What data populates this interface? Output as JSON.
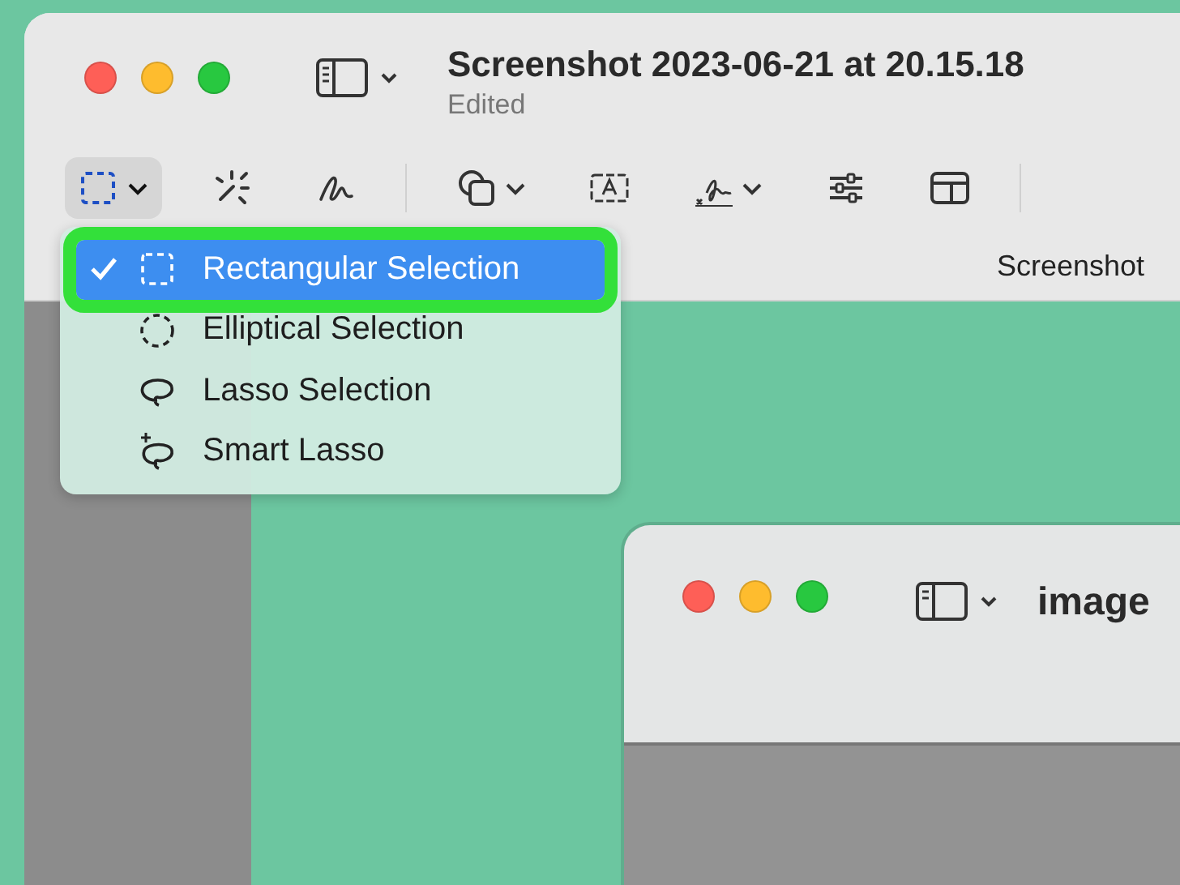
{
  "main_window": {
    "title": "Screenshot 2023-06-21 at 20.15.18",
    "subtitle": "Edited",
    "document_label": "Screenshot",
    "toolbar": [
      {
        "kind": "rect-select",
        "pressed": true,
        "has_menu": true
      },
      {
        "kind": "instant-alpha",
        "pressed": false,
        "has_menu": false
      },
      {
        "kind": "sketch",
        "pressed": false,
        "has_menu": false
      },
      {
        "kind": "divider"
      },
      {
        "kind": "shapes",
        "pressed": false,
        "has_menu": true
      },
      {
        "kind": "text",
        "pressed": false,
        "has_menu": false
      },
      {
        "kind": "sign",
        "pressed": false,
        "has_menu": true
      },
      {
        "kind": "adjust",
        "pressed": false,
        "has_menu": false
      },
      {
        "kind": "layout",
        "pressed": false,
        "has_menu": false
      },
      {
        "kind": "divider"
      }
    ]
  },
  "selection_menu": [
    {
      "label": "Rectangular Selection",
      "kind": "rectangle",
      "selected": true,
      "highlighted": true
    },
    {
      "label": "Elliptical Selection",
      "kind": "ellipse",
      "selected": false,
      "highlighted": false
    },
    {
      "label": "Lasso Selection",
      "kind": "lasso",
      "selected": false,
      "highlighted": false
    },
    {
      "label": "Smart Lasso",
      "kind": "smart-lasso",
      "selected": false,
      "highlighted": false
    }
  ],
  "second_window": {
    "title": "image"
  }
}
